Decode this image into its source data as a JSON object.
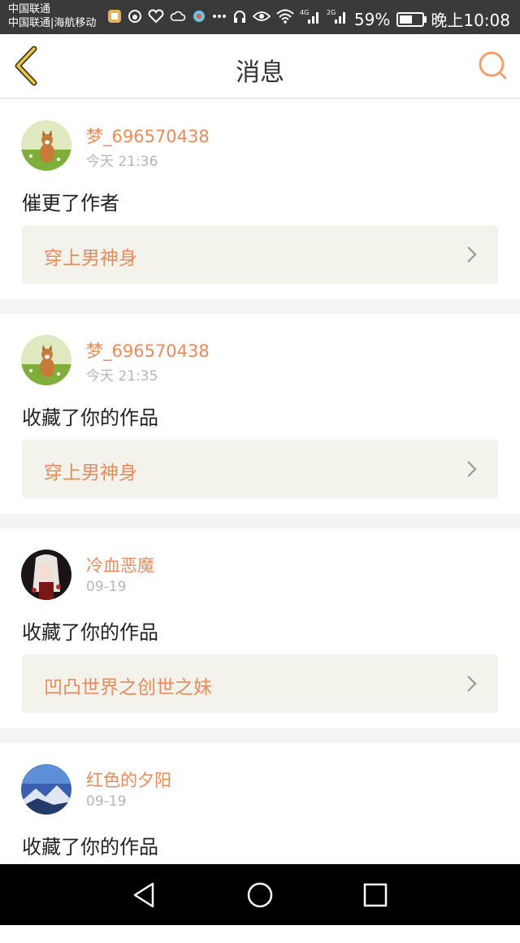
{
  "status_bar": {
    "carrier_1": "中国联通",
    "carrier_2": "中国联通|海航移动",
    "net_1": "4G",
    "net_2": "2G",
    "battery": "59%",
    "battery_level": 0.59,
    "time": "晚上10:08"
  },
  "header": {
    "title": "消息",
    "accent_color": "#e88a5a"
  },
  "messages": [
    {
      "user": "梦_696570438",
      "time": "今天 21:36",
      "action": "催更了作者",
      "book": "穿上男神身",
      "avatar": "dog-avatar"
    },
    {
      "user": "梦_696570438",
      "time": "今天 21:35",
      "action": "收藏了你的作品",
      "book": "穿上男神身",
      "avatar": "dog-avatar"
    },
    {
      "user": "冷血恶魔",
      "time": "09-19",
      "action": "收藏了你的作品",
      "book": "凹凸世界之创世之妹",
      "avatar": "anime-avatar"
    },
    {
      "user": "红色的夕阳",
      "time": "09-19",
      "action": "收藏了你的作品",
      "book": "",
      "avatar": "mountain-avatar"
    }
  ]
}
